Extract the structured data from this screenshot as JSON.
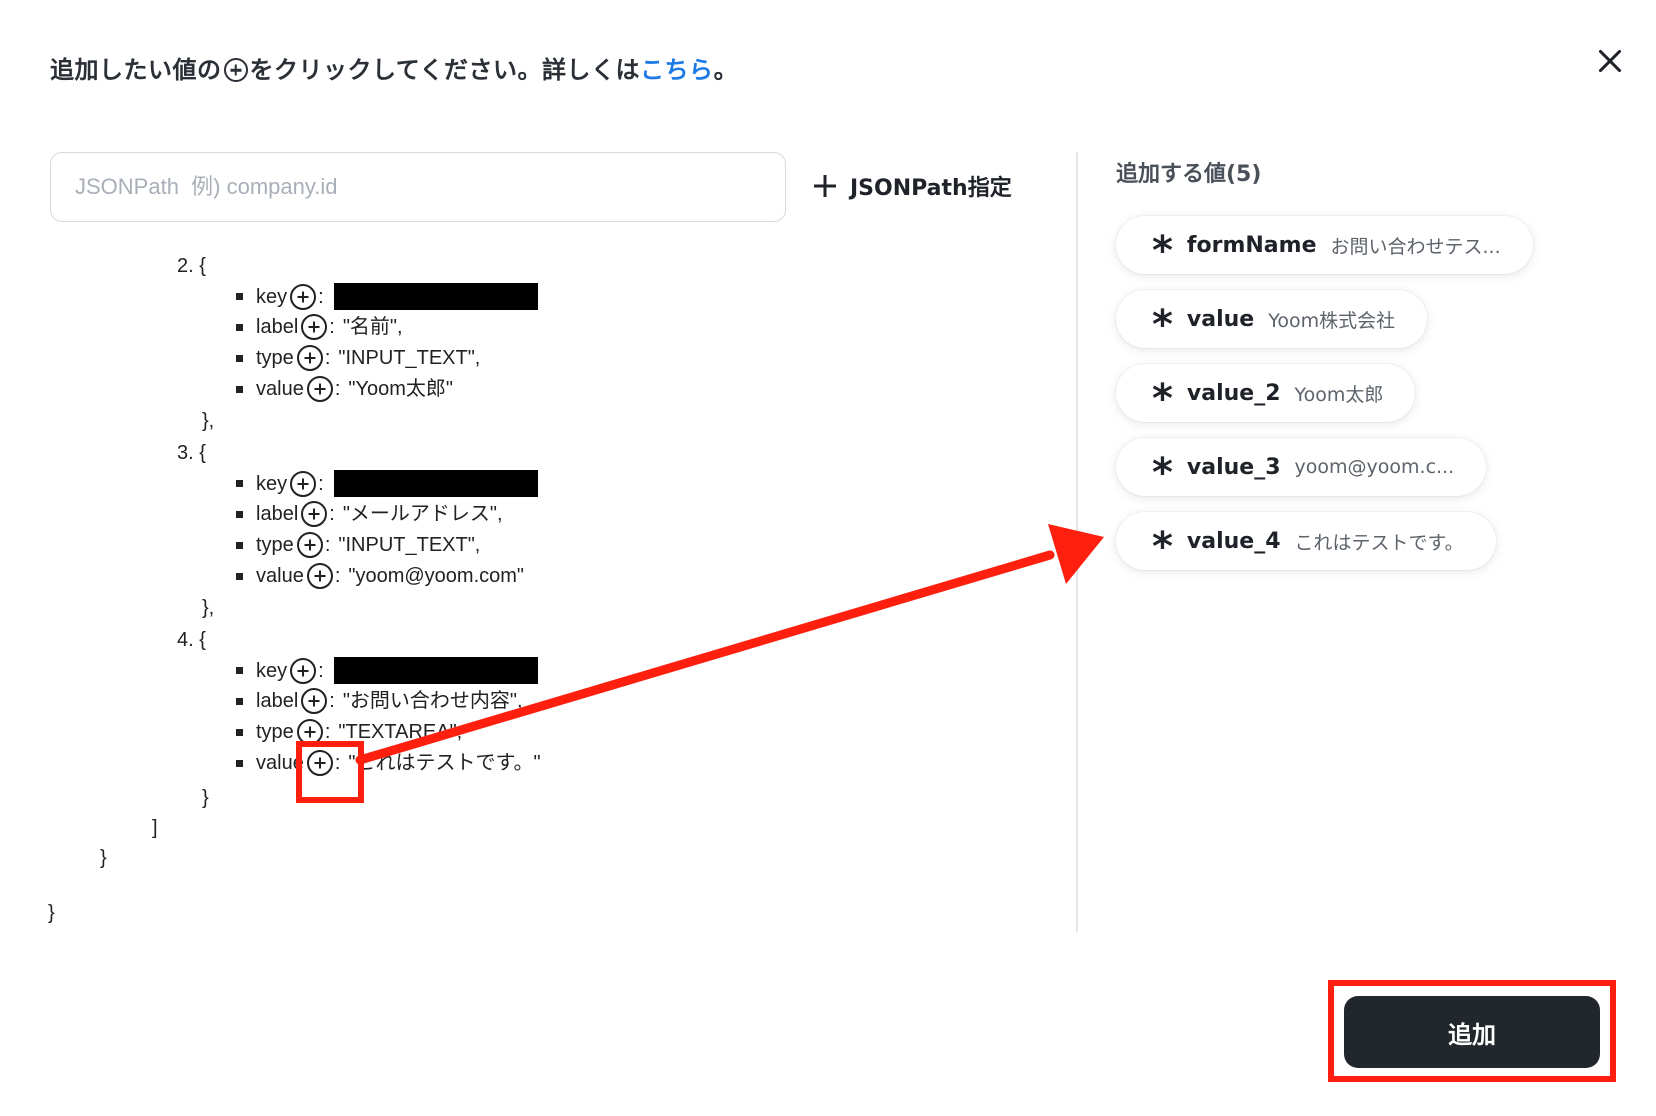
{
  "dialog": {
    "title_before": "追加したい値の",
    "title_after": "をクリックしてください。詳しくは",
    "title_link": "こちら",
    "title_end": "。"
  },
  "search": {
    "placeholder": "JSONPath  例) company.id",
    "button_label": "JSONPath指定"
  },
  "tree": {
    "item2_open": "2. {",
    "item2_label_val": "\"名前\",",
    "item2_type_val": "\"INPUT_TEXT\",",
    "item2_value_val": "\"Yoom太郎\"",
    "item2_close": "},",
    "item3_open": "3. {",
    "item3_label_val": "\"メールアドレス\",",
    "item3_type_val": "\"INPUT_TEXT\",",
    "item3_value_val": "\"yoom@yoom.com\"",
    "item3_close": "},",
    "item4_open": "4. {",
    "item4_label_val": "\"お問い合わせ内容\",",
    "item4_type_val": "\"TEXTAREA\",",
    "item4_value_val": "\"これはテストです。\"",
    "item4_close": "}",
    "array_close": "]",
    "obj_close": "}",
    "root_close": "}",
    "key_key": "key",
    "key_label": "label",
    "key_type": "type",
    "key_value": "value"
  },
  "values_panel": {
    "header": "追加する値(5)",
    "chips": [
      {
        "name": "formName",
        "value": "お問い合わせテス..."
      },
      {
        "name": "value",
        "value": "Yoom株式会社"
      },
      {
        "name": "value_2",
        "value": "Yoom太郎"
      },
      {
        "name": "value_3",
        "value": "yoom@yoom.c..."
      },
      {
        "name": "value_4",
        "value": "これはテストです。"
      }
    ]
  },
  "footer": {
    "add_label": "追加"
  },
  "colors": {
    "accent_link": "#1e7ae6",
    "annotation_red": "#ff1f0f",
    "button_dark": "#22262d"
  }
}
